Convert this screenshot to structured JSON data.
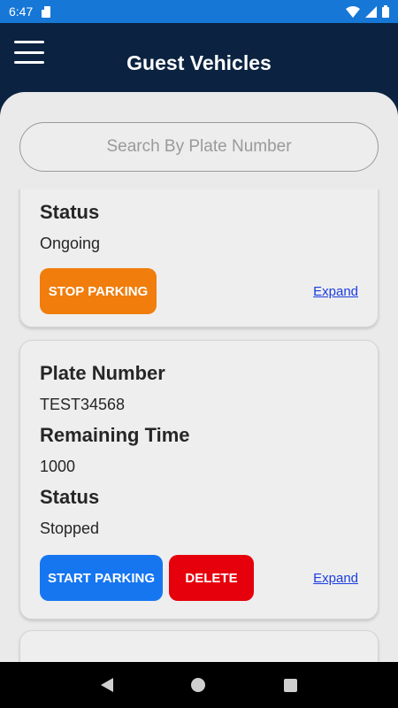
{
  "status_bar": {
    "time": "6:47",
    "icons": [
      "sd-card-icon",
      "wifi-icon",
      "signal-icon",
      "battery-icon"
    ]
  },
  "header": {
    "title": "Guest Vehicles",
    "menu_icon": "hamburger-menu-icon"
  },
  "search": {
    "placeholder": "Search By Plate Number",
    "value": ""
  },
  "vehicles": [
    {
      "status_label": "Status",
      "status": "Ongoing",
      "primary_action": "STOP PARKING",
      "expand_label": "Expand"
    },
    {
      "plate_label": "Plate Number",
      "plate": "TEST34568",
      "remaining_label": "Remaining Time",
      "remaining": "1000",
      "status_label": "Status",
      "status": "Stopped",
      "primary_action": "START PARKING",
      "secondary_action": "DELETE",
      "expand_label": "Expand"
    }
  ],
  "colors": {
    "status_bar": "#1677d6",
    "header": "#0b2340",
    "stop_button": "#f07d0c",
    "start_button": "#1676f0",
    "delete_button": "#e5000b",
    "link": "#1a3de0"
  },
  "nav": {
    "icons": [
      "back-icon",
      "home-icon",
      "recents-icon"
    ]
  }
}
